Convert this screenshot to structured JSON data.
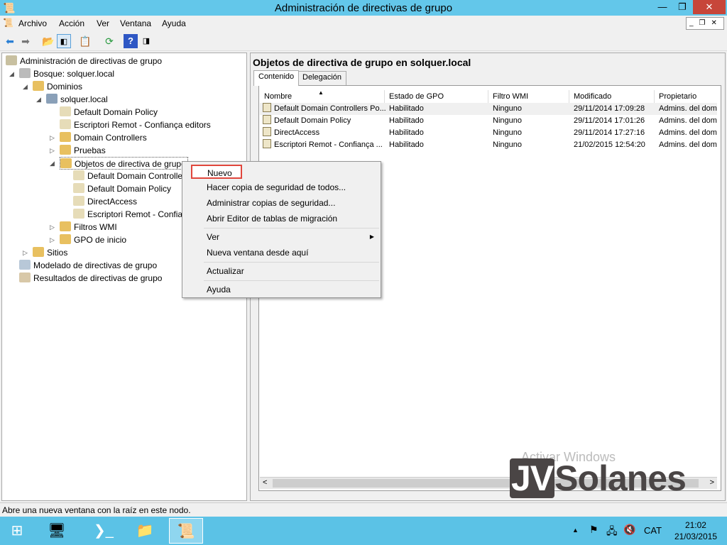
{
  "window": {
    "title": "Administración de directivas de grupo",
    "minimize": "—",
    "maximize": "❐",
    "close": "✕"
  },
  "menu": [
    "Archivo",
    "Acción",
    "Ver",
    "Ventana",
    "Ayuda"
  ],
  "toolbar_icons": [
    "back-icon",
    "forward-icon",
    "up-folder-icon",
    "show-hide-console-tree-icon",
    "export-icon",
    "refresh-icon",
    "help-icon",
    "show-action-pane-icon"
  ],
  "tree": [
    {
      "label": "Administración de directivas de grupo",
      "level": 0,
      "icon": "gpmc-icon"
    },
    {
      "label": "Bosque: solquer.local",
      "level": 1,
      "icon": "forest-icon",
      "expanded": true
    },
    {
      "label": "Dominios",
      "level": 2,
      "icon": "domains-folder-icon",
      "expanded": true
    },
    {
      "label": "solquer.local",
      "level": 3,
      "icon": "domain-icon",
      "expanded": true
    },
    {
      "label": "Default Domain Policy",
      "level": 4,
      "icon": "gpo-link-icon"
    },
    {
      "label": "Escriptori Remot - Confiança editors",
      "level": 4,
      "icon": "gpo-link-icon"
    },
    {
      "label": "Domain Controllers",
      "level": 4,
      "icon": "ou-folder-icon",
      "expanded": false
    },
    {
      "label": "Pruebas",
      "level": 4,
      "icon": "ou-folder-icon",
      "expanded": false
    },
    {
      "label": "Objetos de directiva de grupo",
      "level": 4,
      "icon": "gpo-folder-icon",
      "expanded": true,
      "selected": true
    },
    {
      "label": "Default Domain Controllers Policy",
      "level": 5,
      "icon": "gpo-icon"
    },
    {
      "label": "Default Domain Policy",
      "level": 5,
      "icon": "gpo-icon"
    },
    {
      "label": "DirectAccess",
      "level": 5,
      "icon": "gpo-icon"
    },
    {
      "label": "Escriptori Remot - Confiança editors",
      "level": 5,
      "icon": "gpo-icon"
    },
    {
      "label": "Filtros WMI",
      "level": 4,
      "icon": "folder-icon",
      "expanded": false
    },
    {
      "label": "GPO de inicio",
      "level": 4,
      "icon": "folder-icon",
      "expanded": false
    },
    {
      "label": "Sitios",
      "level": 2,
      "icon": "sites-icon",
      "expanded": false
    },
    {
      "label": "Modelado de directivas de grupo",
      "level": 1,
      "icon": "modeling-icon"
    },
    {
      "label": "Resultados de directivas de grupo",
      "level": 1,
      "icon": "results-icon"
    }
  ],
  "right": {
    "title": "Objetos de directiva de grupo en solquer.local",
    "tabs": [
      "Contenido",
      "Delegación"
    ],
    "active_tab": "Contenido",
    "columns": [
      "Nombre",
      "Estado de GPO",
      "Filtro WMI",
      "Modificado",
      "Propietario"
    ],
    "rows": [
      [
        "Default Domain Controllers Po...",
        "Habilitado",
        "Ninguno",
        "29/11/2014 17:09:28",
        "Admins. del domi"
      ],
      [
        "Default Domain Policy",
        "Habilitado",
        "Ninguno",
        "29/11/2014 17:01:26",
        "Admins. del domi"
      ],
      [
        "DirectAccess",
        "Habilitado",
        "Ninguno",
        "29/11/2014 17:27:16",
        "Admins. del domi"
      ],
      [
        "Escriptori Remot - Confiança ...",
        "Habilitado",
        "Ninguno",
        "21/02/2015 12:54:20",
        "Admins. del domi"
      ]
    ]
  },
  "context_menu": {
    "items": [
      "Nuevo",
      "Hacer copia de seguridad de todos...",
      "Administrar copias de seguridad...",
      "Abrir Editor de tablas de migración",
      "Ver",
      "Nueva ventana desde aquí",
      "Actualizar",
      "Ayuda"
    ],
    "highlight_color": "#e0463c"
  },
  "status": "Abre una nueva ventana con la raíz en este nodo.",
  "watermark": {
    "activate": "Activar Windows",
    "logo": "JVSolanes"
  },
  "taskbar": {
    "language": "CAT",
    "time": "21:02",
    "date": "21/03/2015",
    "color": "#5bc2e6"
  }
}
